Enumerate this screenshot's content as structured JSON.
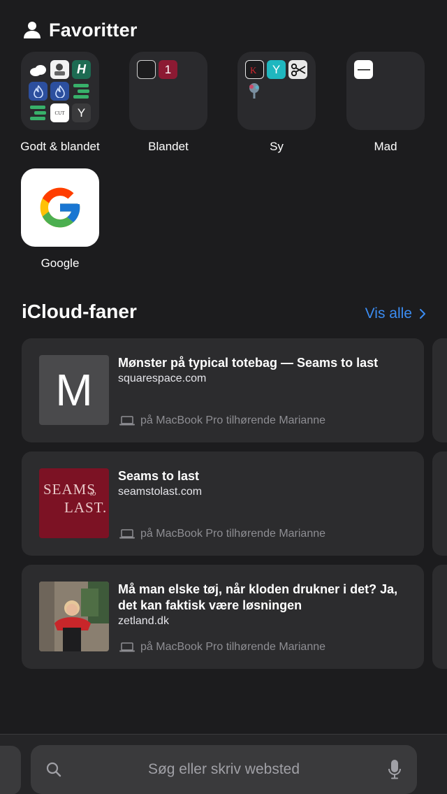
{
  "favorites": {
    "title": "Favoritter",
    "folders": [
      {
        "label": "Godt & blandet"
      },
      {
        "label": "Blandet"
      },
      {
        "label": "Sy"
      },
      {
        "label": "Mad"
      }
    ],
    "google": {
      "label": "Google"
    }
  },
  "mini_icons": {
    "godt_h": "H",
    "godt_y": "Y",
    "blandet_badge": "1",
    "sy_y": "Y",
    "godt_cut": "CUT"
  },
  "icloud": {
    "title": "iCloud-faner",
    "see_all": "Vis alle",
    "tabs": [
      {
        "title": "Mønster på typical totebag — Seams to last",
        "domain": "squarespace.com",
        "device": "på MacBook Pro tilhørende Marianne",
        "thumb_letter": "M"
      },
      {
        "title": "Seams to last",
        "domain": "seamstolast.com",
        "device": "på MacBook Pro tilhørende Marianne",
        "thumb_line1": "SEAMS",
        "thumb_to": "to",
        "thumb_line2": "LAST."
      },
      {
        "title": "Må man elske tøj, når kloden drukner i det? Ja, det kan faktisk være løsningen",
        "domain": "zetland.dk",
        "device": "på MacBook Pro tilhørende Marianne"
      }
    ]
  },
  "search": {
    "placeholder": "Søg eller skriv websted"
  },
  "colors": {
    "background": "#1c1c1e",
    "card": "#2c2c2e",
    "accent": "#3b8cf2",
    "secondary_text": "#8e8e93"
  }
}
